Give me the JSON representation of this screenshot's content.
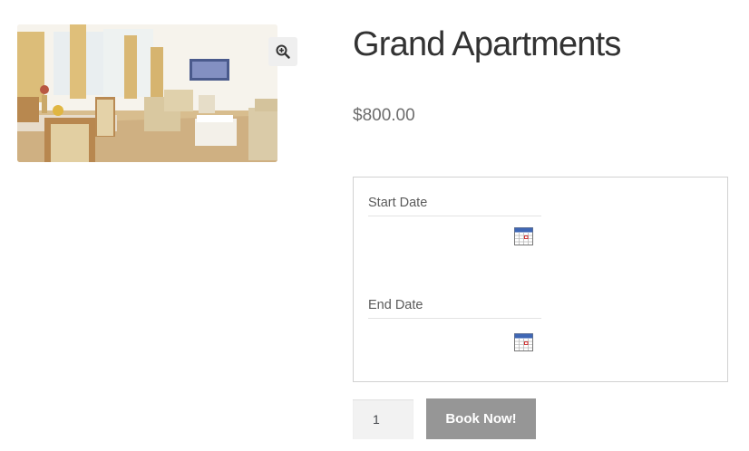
{
  "product": {
    "title": "Grand Apartments",
    "price": "$800.00",
    "image_alt": "Apartment living room"
  },
  "gallery": {
    "zoom_icon": "zoom-in-icon"
  },
  "booking": {
    "start_date_label": "Start Date",
    "start_date_value": "",
    "end_date_label": "End Date",
    "end_date_value": "",
    "calendar_icon": "calendar-icon"
  },
  "cart": {
    "quantity": "1",
    "book_button_label": "Book Now!"
  },
  "colors": {
    "button_bg": "#969696",
    "button_text": "#ffffff",
    "border": "#d1d1d1",
    "title": "#333333",
    "price": "#6d6d6d"
  }
}
